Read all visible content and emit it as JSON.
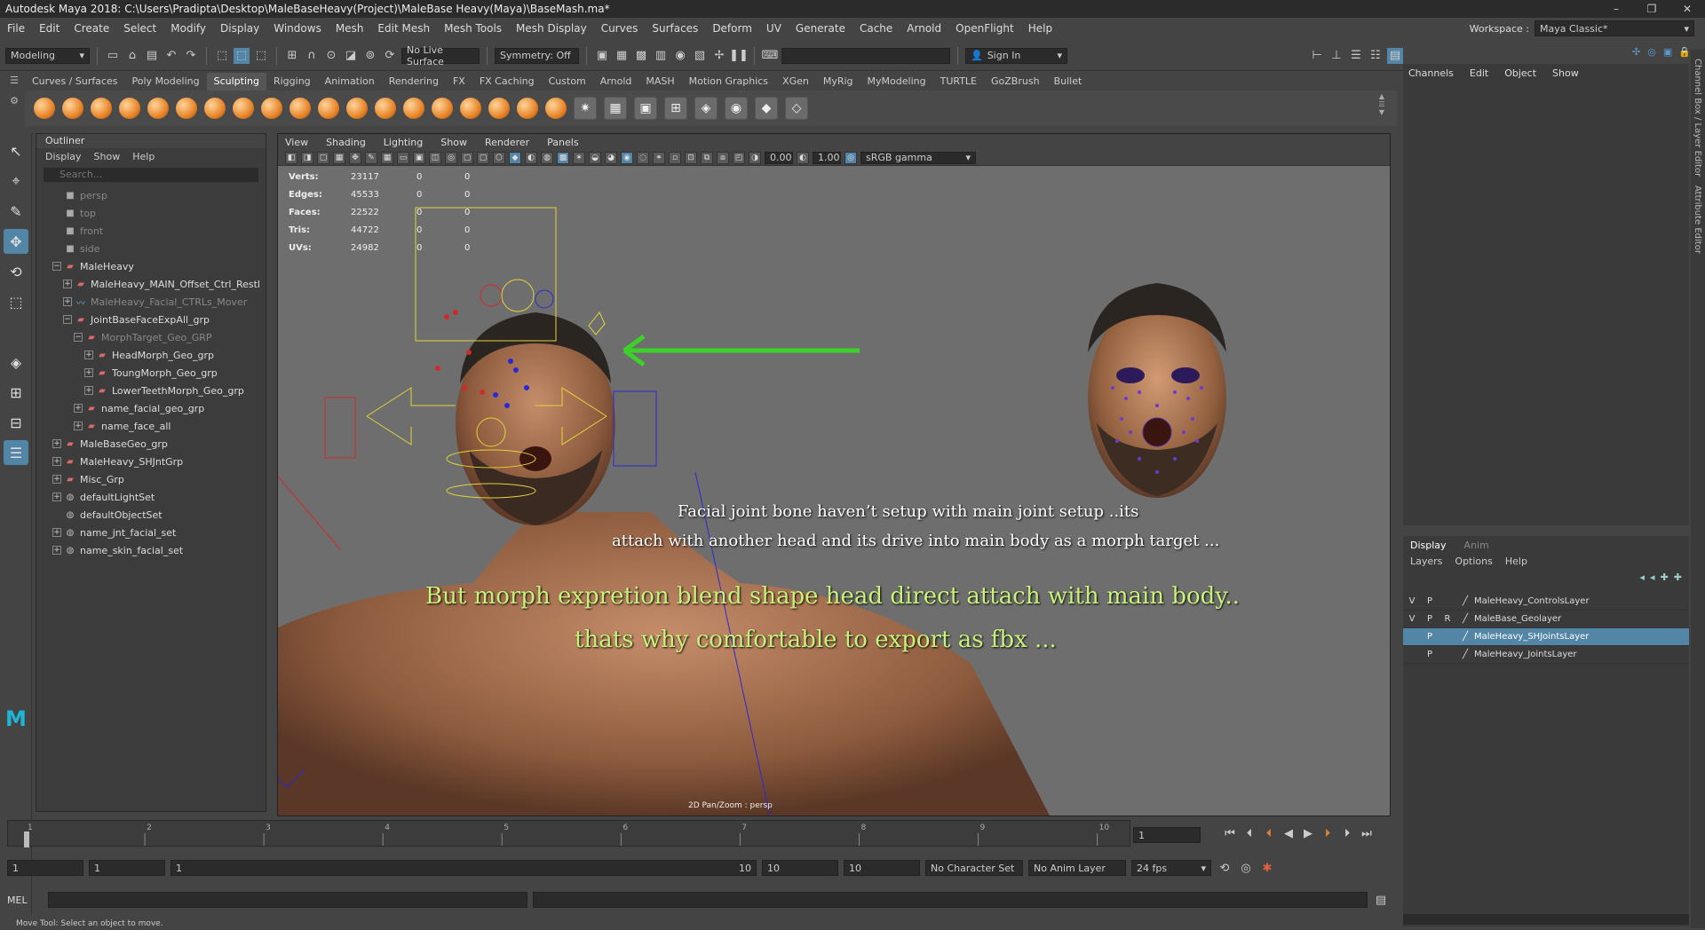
{
  "title": "Autodesk Maya 2018: C:\\Users\\Pradipta\\Desktop\\MaleBaseHeavy(Project)\\MaleBase Heavy(Maya)\\BaseMash.ma*",
  "window_buttons": [
    "–",
    "❐",
    "✕"
  ],
  "menu": [
    "File",
    "Edit",
    "Create",
    "Select",
    "Modify",
    "Display",
    "Windows",
    "Mesh",
    "Edit Mesh",
    "Mesh Tools",
    "Mesh Display",
    "Curves",
    "Surfaces",
    "Deform",
    "UV",
    "Generate",
    "Cache",
    "Arnold",
    "OpenFlight",
    "Help"
  ],
  "workspace": {
    "label": "Workspace :",
    "value": "Maya Classic*"
  },
  "status": {
    "mode": "Modeling",
    "live_surface": "No Live Surface",
    "symmetry": "Symmetry: Off",
    "sign_in": "Sign In"
  },
  "shelf_tabs": [
    "Curves / Surfaces",
    "Poly Modeling",
    "Sculpting",
    "Rigging",
    "Animation",
    "Rendering",
    "FX",
    "FX Caching",
    "Custom",
    "Arnold",
    "MASH",
    "Motion Graphics",
    "XGen",
    "MyRig",
    "MyModeling",
    "TURTLE",
    "GoZBrush",
    "Bullet"
  ],
  "outliner": {
    "title": "Outliner",
    "menu": [
      "Display",
      "Show",
      "Help"
    ],
    "search": "Search...",
    "items": [
      {
        "label": "persp",
        "level": 0,
        "icon": "camera-icon",
        "dim": true,
        "exp": ""
      },
      {
        "label": "top",
        "level": 0,
        "icon": "camera-icon",
        "dim": true,
        "exp": ""
      },
      {
        "label": "front",
        "level": 0,
        "icon": "camera-icon",
        "dim": true,
        "exp": ""
      },
      {
        "label": "side",
        "level": 0,
        "icon": "camera-icon",
        "dim": true,
        "exp": ""
      },
      {
        "label": "MaleHeavy",
        "level": 0,
        "icon": "transform-icon",
        "dim": false,
        "exp": "−"
      },
      {
        "label": "MaleHeavy_MAIN_Offset_Ctrl_Restl",
        "level": 1,
        "icon": "transform-icon",
        "dim": false,
        "exp": "+"
      },
      {
        "label": "MaleHeavy_Facial_CTRLs_Mover",
        "level": 1,
        "icon": "curve-icon",
        "dim": true,
        "exp": "+"
      },
      {
        "label": "JointBaseFaceExpAll_grp",
        "level": 1,
        "icon": "transform-icon",
        "dim": false,
        "exp": "−"
      },
      {
        "label": "MorphTarget_Geo_GRP",
        "level": 2,
        "icon": "transform-icon",
        "dim": true,
        "exp": "−"
      },
      {
        "label": "HeadMorph_Geo_grp",
        "level": 3,
        "icon": "transform-icon",
        "dim": false,
        "exp": "+"
      },
      {
        "label": "ToungMorph_Geo_grp",
        "level": 3,
        "icon": "transform-icon",
        "dim": false,
        "exp": "+"
      },
      {
        "label": "LowerTeethMorph_Geo_grp",
        "level": 3,
        "icon": "transform-icon",
        "dim": false,
        "exp": "+"
      },
      {
        "label": "name_facial_geo_grp",
        "level": 2,
        "icon": "transform-icon",
        "dim": false,
        "exp": "+"
      },
      {
        "label": "name_face_all",
        "level": 2,
        "icon": "transform-icon",
        "dim": false,
        "exp": "+"
      },
      {
        "label": "MaleBaseGeo_grp",
        "level": 0,
        "icon": "transform-icon",
        "dim": false,
        "exp": "+"
      },
      {
        "label": "MaleHeavy_SHJntGrp",
        "level": 0,
        "icon": "transform-icon",
        "dim": false,
        "exp": "+"
      },
      {
        "label": "Misc_Grp",
        "level": 0,
        "icon": "transform-icon",
        "dim": false,
        "exp": "+"
      },
      {
        "label": "defaultLightSet",
        "level": 0,
        "icon": "set-icon",
        "dim": false,
        "exp": "+"
      },
      {
        "label": "defaultObjectSet",
        "level": 0,
        "icon": "set-icon",
        "dim": false,
        "exp": ""
      },
      {
        "label": "name_jnt_facial_set",
        "level": 0,
        "icon": "set-icon",
        "dim": false,
        "exp": "+"
      },
      {
        "label": "name_skin_facial_set",
        "level": 0,
        "icon": "set-icon",
        "dim": false,
        "exp": "+"
      }
    ]
  },
  "viewport": {
    "menu": [
      "View",
      "Shading",
      "Lighting",
      "Show",
      "Renderer",
      "Panels"
    ],
    "exposure": "0.00",
    "gamma": "1.00",
    "color_space": "sRGB gamma",
    "hud": [
      [
        "Verts:",
        "23117",
        "0",
        "0"
      ],
      [
        "Edges:",
        "45533",
        "0",
        "0"
      ],
      [
        "Faces:",
        "22522",
        "0",
        "0"
      ],
      [
        "Tris:",
        "44722",
        "0",
        "0"
      ],
      [
        "UVs:",
        "24982",
        "0",
        "0"
      ]
    ],
    "camera_label": "2D Pan/Zoom : persp",
    "captions": [
      "Facial joint bone haven’t setup with main joint setup ..its",
      "attach with another head and its drive into main body as a morph target ...",
      "But morph expretion blend shape head direct attach with main body..",
      "thats why comfortable to export as fbx ..."
    ]
  },
  "channel_box": {
    "menu": [
      "Channels",
      "Edit",
      "Object",
      "Show"
    ]
  },
  "layer_editor": {
    "tabs": [
      "Display",
      "Anim"
    ],
    "menu": [
      "Layers",
      "Options",
      "Help"
    ],
    "layers": [
      {
        "v": "V",
        "p": "P",
        "r": "",
        "name": "MaleHeavy_ControlsLayer",
        "selected": false
      },
      {
        "v": "V",
        "p": "P",
        "r": "R",
        "name": "MaleBase_Geolayer",
        "selected": false
      },
      {
        "v": "",
        "p": "P",
        "r": "",
        "name": "MaleHeavy_SHJointsLayer",
        "selected": true
      },
      {
        "v": "",
        "p": "P",
        "r": "",
        "name": "MaleHeavy_JointsLayer",
        "selected": false
      }
    ]
  },
  "side_tabs": [
    "Channel Box / Layer Editor",
    "Attribute Editor"
  ],
  "timeline": {
    "ticks": [
      "1",
      "2",
      "3",
      "4",
      "5",
      "6",
      "7",
      "8",
      "9",
      "10"
    ],
    "current_frame": "1"
  },
  "range": {
    "start": "1",
    "playback_start": "1",
    "slider_start": "1",
    "slider_end": "10",
    "playback_end": "10",
    "end": "10",
    "character_set": "No Character Set",
    "anim_layer": "No Anim Layer",
    "fps": "24 fps"
  },
  "cmd": {
    "label": "MEL"
  },
  "help_line": "Move Tool: Select an object to move.",
  "colors": {
    "accent": "#5285a6",
    "caption_green": "#c8f27a",
    "arrow_green": "#3ed12b"
  }
}
